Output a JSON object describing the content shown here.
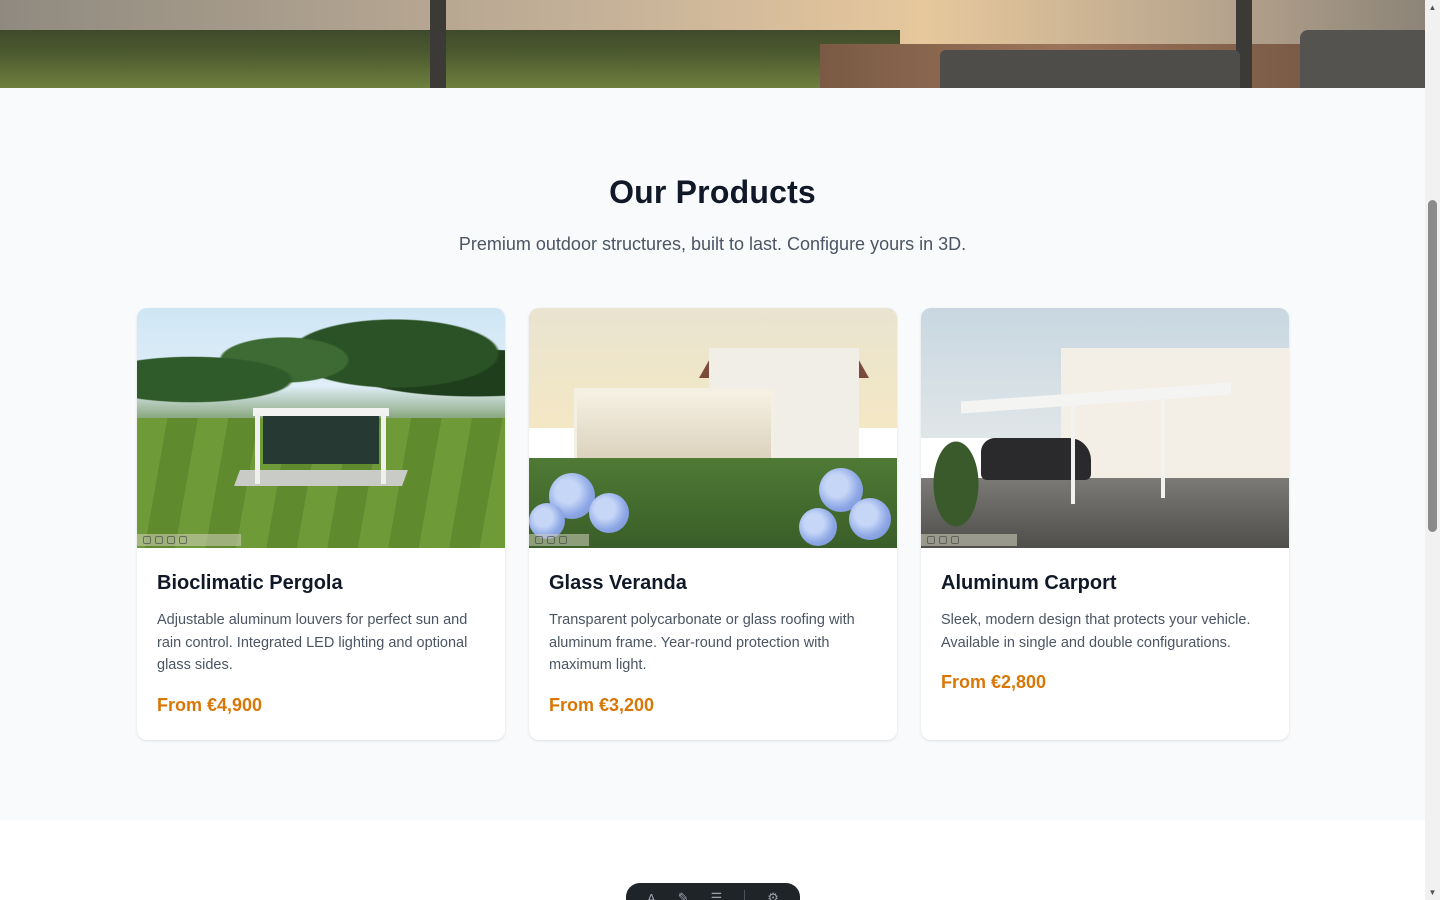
{
  "products_section": {
    "title": "Our Products",
    "subtitle": "Premium outdoor structures, built to last. Configure yours in 3D."
  },
  "products": [
    {
      "name": "Bioclimatic Pergola",
      "description": "Adjustable aluminum louvers for perfect sun and rain control. Integrated LED lighting and optional glass sides.",
      "price": "From €4,900",
      "image_icon": "pergola-scene"
    },
    {
      "name": "Glass Veranda",
      "description": "Transparent polycarbonate or glass roofing with aluminum frame. Year-round protection with maximum light.",
      "price": "From €3,200",
      "image_icon": "veranda-scene"
    },
    {
      "name": "Aluminum Carport",
      "description": "Sleek, modern design that protects your vehicle. Available in single and double configurations.",
      "price": "From €2,800",
      "image_icon": "carport-scene"
    }
  ],
  "colors": {
    "accent_price": "#d97706",
    "section_bg": "#f8fafc",
    "heading": "#111827",
    "body_text": "#4b5563",
    "floating_bar": "#1f2428"
  },
  "floating_toolbar": {
    "icons": [
      "text-icon",
      "brush-icon",
      "menu-icon",
      "settings-icon"
    ]
  }
}
